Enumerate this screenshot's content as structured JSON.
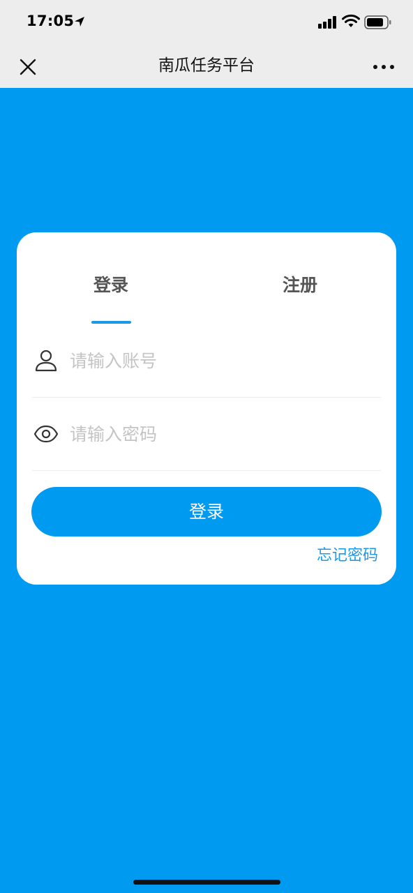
{
  "status_bar": {
    "time": "17:05",
    "location_icon": "location-arrow-icon",
    "signal_icon": "cellular-signal-icon",
    "wifi_icon": "wifi-icon",
    "battery_icon": "battery-icon"
  },
  "nav_bar": {
    "title": "南瓜任务平台",
    "close_icon": "close-icon",
    "more_icon": "more-dots-icon"
  },
  "auth": {
    "tabs": [
      {
        "label": "登录",
        "active": true
      },
      {
        "label": "注册",
        "active": false
      }
    ],
    "account": {
      "placeholder": "请输入账号",
      "value": "",
      "icon": "user-icon"
    },
    "password": {
      "placeholder": "请输入密码",
      "value": "",
      "icon": "eye-icon"
    },
    "submit_label": "登录",
    "forgot_label": "忘记密码"
  },
  "colors": {
    "accent": "#019af1",
    "page_background": "#019af1",
    "header_background": "#ededed",
    "card_background": "#ffffff",
    "placeholder_text": "#c4c4c4"
  }
}
